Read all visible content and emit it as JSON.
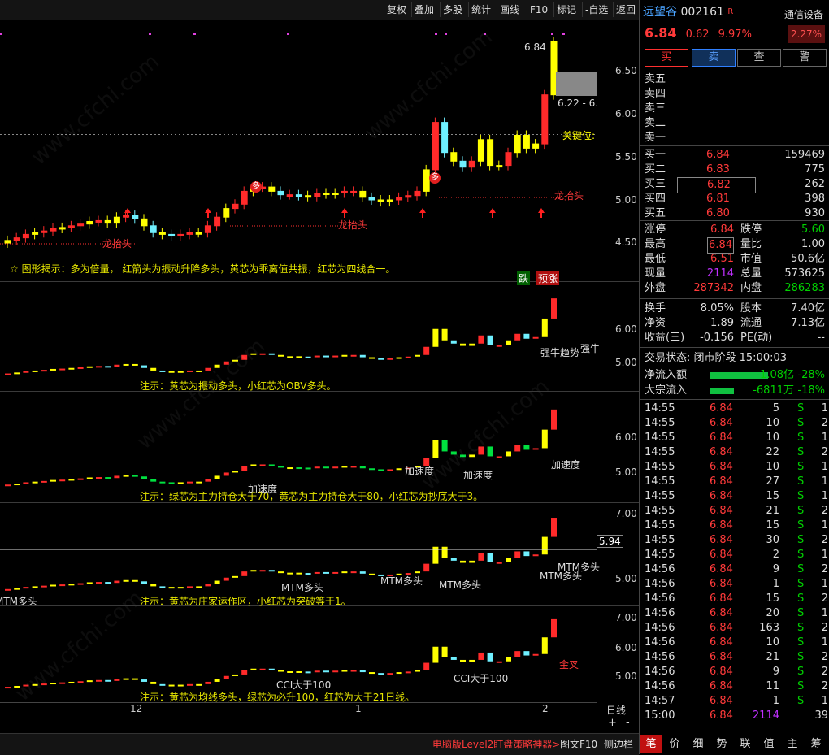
{
  "toolbar": {
    "buttons": [
      "复权",
      "叠加",
      "多股",
      "统计",
      "画线",
      "F10",
      "标记",
      "-自选",
      "返回"
    ]
  },
  "watermark": "www.cfchi.com",
  "stock": {
    "name": "远望谷",
    "code": "002161",
    "flag": "R",
    "price": "6.84",
    "change": "0.62",
    "pct": "9.97%",
    "device": "通信设备",
    "device_pct": "2.27%"
  },
  "actions": [
    "买",
    "卖",
    "查",
    "警"
  ],
  "sell_levels": [
    "卖五",
    "卖四",
    "卖三",
    "卖二",
    "卖一"
  ],
  "buy_levels": [
    {
      "label": "买一",
      "price": "6.84",
      "vol": "159469"
    },
    {
      "label": "买二",
      "price": "6.83",
      "vol": "775"
    },
    {
      "label": "买三",
      "price": "6.82",
      "vol": "262"
    },
    {
      "label": "买四",
      "price": "6.81",
      "vol": "398"
    },
    {
      "label": "买五",
      "price": "6.80",
      "vol": "930"
    }
  ],
  "stats": [
    {
      "l1": "涨停",
      "v1": "6.84",
      "c1": "red",
      "l2": "跌停",
      "v2": "5.60",
      "c2": "green"
    },
    {
      "l1": "最高",
      "v1": "6.84",
      "c1": "red",
      "l2": "量比",
      "v2": "1.00",
      "c2": "white"
    },
    {
      "l1": "最低",
      "v1": "6.51",
      "c1": "red",
      "l2": "市值",
      "v2": "50.6亿",
      "c2": "white"
    },
    {
      "l1": "现量",
      "v1": "2114",
      "c1": "purple",
      "l2": "总量",
      "v2": "573625",
      "c2": "white"
    },
    {
      "l1": "外盘",
      "v1": "287342",
      "c1": "red",
      "l2": "内盘",
      "v2": "286283",
      "c2": "green"
    }
  ],
  "stats2": [
    {
      "l1": "换手",
      "v1": "8.05%",
      "l2": "股本",
      "v2": "7.40亿"
    },
    {
      "l1": "净资",
      "v1": "1.89",
      "l2": "流通",
      "v2": "7.13亿"
    },
    {
      "l1": "收益(三)",
      "v1": "-0.156",
      "l2": "PE(动)",
      "v2": "--"
    }
  ],
  "trade_status": "交易状态: 闭市阶段 15:00:03",
  "flows": [
    {
      "label": "净流入额",
      "value": "-1.08亿",
      "pct": "-28%"
    },
    {
      "label": "大宗流入",
      "value": "-6811万",
      "pct": "-18%"
    }
  ],
  "ticks": [
    [
      "14:55",
      "6.84",
      "5",
      "S",
      "1"
    ],
    [
      "14:55",
      "6.84",
      "10",
      "S",
      "2"
    ],
    [
      "14:55",
      "6.84",
      "10",
      "S",
      "1"
    ],
    [
      "14:55",
      "6.84",
      "22",
      "S",
      "2"
    ],
    [
      "14:55",
      "6.84",
      "10",
      "S",
      "1"
    ],
    [
      "14:55",
      "6.84",
      "27",
      "S",
      "1"
    ],
    [
      "14:55",
      "6.84",
      "15",
      "S",
      "1"
    ],
    [
      "14:55",
      "6.84",
      "21",
      "S",
      "2"
    ],
    [
      "14:55",
      "6.84",
      "15",
      "S",
      "1"
    ],
    [
      "14:55",
      "6.84",
      "30",
      "S",
      "2"
    ],
    [
      "14:55",
      "6.84",
      "2",
      "S",
      "1"
    ],
    [
      "14:56",
      "6.84",
      "9",
      "S",
      "2"
    ],
    [
      "14:56",
      "6.84",
      "1",
      "S",
      "1"
    ],
    [
      "14:56",
      "6.84",
      "15",
      "S",
      "2"
    ],
    [
      "14:56",
      "6.84",
      "20",
      "S",
      "1"
    ],
    [
      "14:56",
      "6.84",
      "163",
      "S",
      "2"
    ],
    [
      "14:56",
      "6.84",
      "10",
      "S",
      "1"
    ],
    [
      "14:56",
      "6.84",
      "21",
      "S",
      "2"
    ],
    [
      "14:56",
      "6.84",
      "9",
      "S",
      "2"
    ],
    [
      "14:56",
      "6.84",
      "11",
      "S",
      "2"
    ],
    [
      "14:57",
      "6.84",
      "1",
      "S",
      "1"
    ],
    [
      "15:00",
      "6.84",
      "2114",
      "",
      "39"
    ]
  ],
  "right_tabs": [
    "笔",
    "价",
    "细",
    "势",
    "联",
    "值",
    "主",
    "筹"
  ],
  "axes": {
    "main": [
      "6.50",
      "6.00",
      "5.50",
      "5.00",
      "4.50"
    ],
    "p2": [
      "6.00",
      "5.00"
    ],
    "p3": [
      "6.00",
      "5.00"
    ],
    "p4": [
      "7.00",
      "6.00",
      "5.00"
    ],
    "p5": [
      "7.00",
      "6.00",
      "5.00"
    ],
    "p4_marker": "5.94"
  },
  "dates": [
    "12",
    "1",
    "2"
  ],
  "period": "日线",
  "zoom": [
    "+",
    "-"
  ],
  "notes": {
    "main": "☆ 图形揭示：多为倍量， 红箭头为振动升降多头，黄芯为乖离值共振，红芯为四线合一。",
    "p2": "注示：黄芯为振动多头，小红芯为OBV多头。",
    "p3": "注示：绿芯为主力持仓大于70，黄芯为主力持仓大于80，小红芯为抄底大于3。",
    "p4": "注示：黄芯为庄家运作区，小红芯为突破等于1。",
    "p5": "注示：黄芯为均线多头，绿芯为必升100，红芯为大于21日线。"
  },
  "annotations": {
    "high": "6.84",
    "range": "6.22 - 6.",
    "key": "关键位:",
    "dragon": "龙抬头",
    "duo": "多",
    "die": "跌",
    "yuzhang": "预涨",
    "strong": "强牛趋势",
    "strong2": "强牛",
    "accel": "加速度",
    "mtm": "MTM多头",
    "cci": "CCI大于100",
    "gold": "金叉"
  },
  "bottom": {
    "promo": "电脑版Level2盯盘策略神器>",
    "f10": "图文F10",
    "sidebar": "侧边栏"
  },
  "colors": {
    "up": "#ff2a2a",
    "down": "#00e040",
    "yellow": "#ffff00",
    "cyan": "#6ff0ff",
    "bg": "#000000"
  }
}
